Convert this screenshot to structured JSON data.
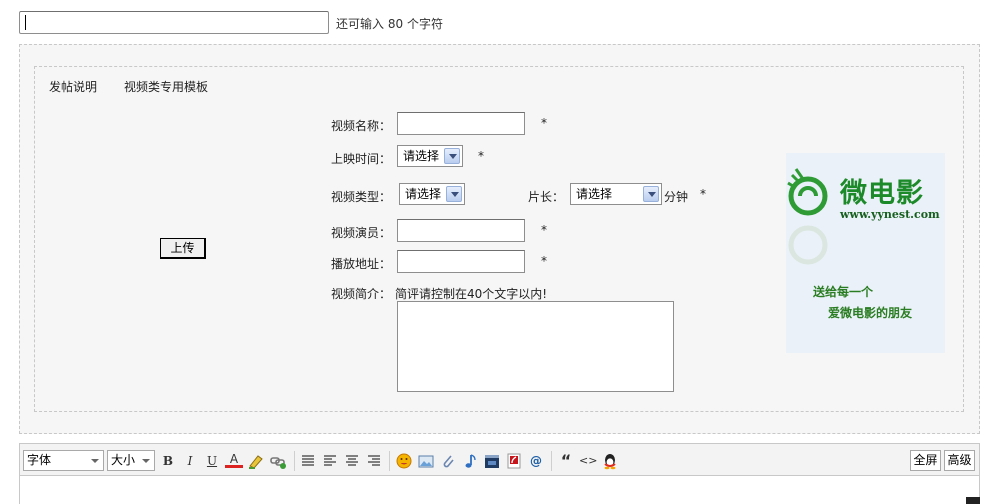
{
  "title_field": {
    "value": "",
    "remain_prefix": "还可输入",
    "remain_count": "80",
    "remain_suffix": "个字符"
  },
  "tabs": [
    "发帖说明",
    "视频类专用模板"
  ],
  "upload_label": "上传",
  "form": {
    "name_label": "视频名称：",
    "release_label": "上映时间：",
    "release_value": "请选择",
    "type_label": "视频类型：",
    "type_value": "请选择",
    "length_label": "片长：",
    "length_value": "请选择",
    "length_unit": "分钟",
    "actor_label": "视频演员：",
    "url_label": "播放地址：",
    "intro_label": "视频简介：",
    "intro_hint": "简评请控制在40个文字以内!",
    "required_mark": "*"
  },
  "ad": {
    "title": "微电影",
    "url": "www.yynest.com",
    "line1": "送给每一个",
    "line2": "爱微电影的朋友"
  },
  "toolbar": {
    "font_label": "字体",
    "size_label": "大小",
    "fullscreen_label": "全屏",
    "advanced_label": "高级",
    "bold": "B",
    "italic": "I",
    "underline": "U",
    "color": "A",
    "quote": "“",
    "code": "<>",
    "at": "@"
  }
}
